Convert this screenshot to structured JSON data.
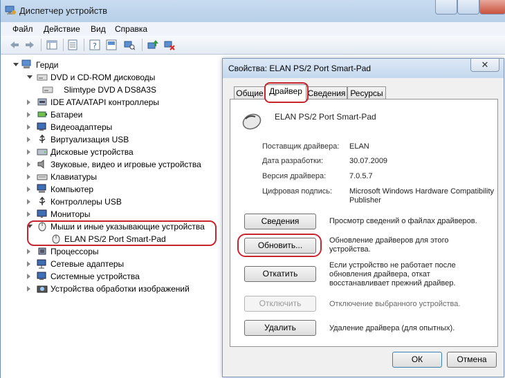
{
  "window": {
    "title": "Диспетчер устройств"
  },
  "menu": {
    "file": "Файл",
    "action": "Действие",
    "view": "Вид",
    "help": "Справка"
  },
  "tree": {
    "root": "Герди",
    "dvd": "DVD и CD-ROM дисководы",
    "dvd_child": "Slimtype DVD A  DS8A3S",
    "ide": "IDE ATA/ATAPI контроллеры",
    "batteries": "Батареи",
    "video": "Видеоадаптеры",
    "usb_virt": "Виртуализация USB",
    "disks": "Дисковые устройства",
    "sound": "Звуковые, видео и игровые устройства",
    "keyboards": "Клавиатуры",
    "computer": "Компьютер",
    "usb_ctrl": "Контроллеры USB",
    "monitors": "Мониторы",
    "mice": "Мыши и иные указывающие устройства",
    "mice_child": "ELAN PS/2 Port Smart-Pad",
    "cpus": "Процессоры",
    "net": "Сетевые адаптеры",
    "system": "Системные устройства",
    "imaging": "Устройства обработки изображений"
  },
  "dialog": {
    "title": "Свойства: ELAN PS/2 Port Smart-Pad",
    "close": "✕",
    "tabs": {
      "general": "Общие",
      "driver": "Драйвер",
      "details": "Сведения",
      "resources": "Ресурсы"
    },
    "device_name": "ELAN PS/2 Port Smart-Pad",
    "provider_label": "Поставщик драйвера:",
    "provider_value": "ELAN",
    "date_label": "Дата разработки:",
    "date_value": "30.07.2009",
    "version_label": "Версия драйвера:",
    "version_value": "7.0.5.7",
    "signer_label": "Цифровая подпись:",
    "signer_value_1": "Microsoft Windows Hardware Compatibility",
    "signer_value_2": "Publisher",
    "btn_details": "Сведения",
    "desc_details": "Просмотр сведений о файлах драйверов.",
    "btn_update": "Обновить...",
    "desc_update_1": "Обновление драйверов для этого",
    "desc_update_2": "устройства.",
    "btn_rollback": "Откатить",
    "desc_rollback_1": "Если устройство не работает после",
    "desc_rollback_2": "обновления драйвера, откат",
    "desc_rollback_3": "восстанавливает прежний драйвер.",
    "btn_disable": "Отключить",
    "desc_disable": "Отключение выбранного устройства.",
    "btn_uninstall": "Удалить",
    "desc_uninstall": "Удаление драйвера (для опытных).",
    "btn_ok": "ОК",
    "btn_cancel": "Отмена"
  },
  "colors": {
    "highlight": "#c8252f",
    "titlebar": "#c4d8ee"
  }
}
